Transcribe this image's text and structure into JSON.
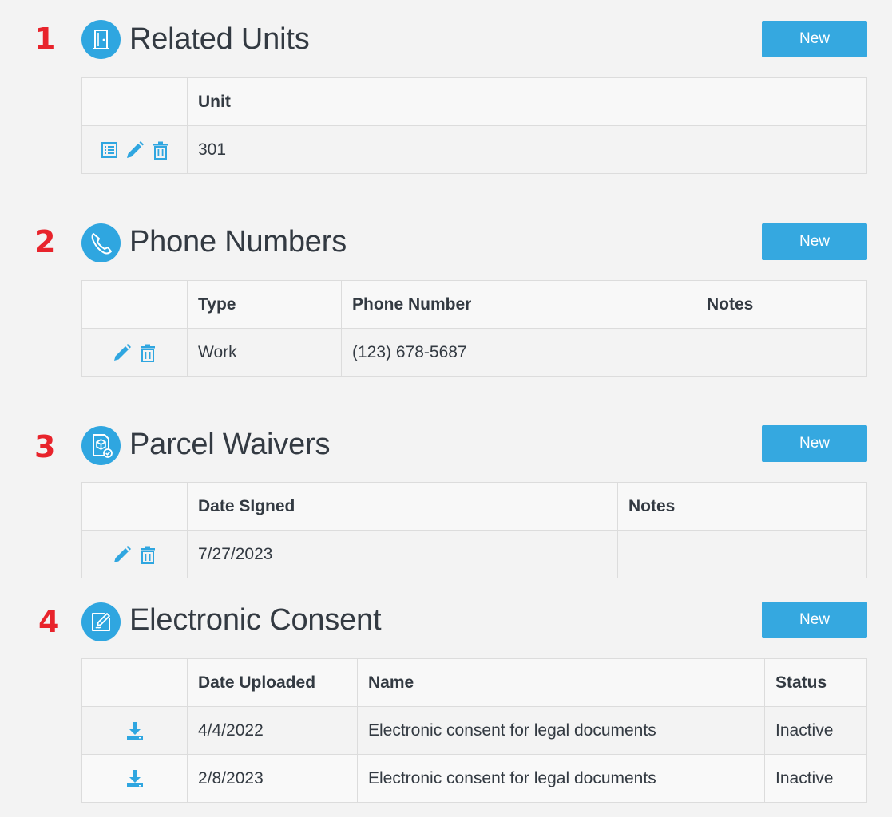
{
  "accent_color": "#2fa6e0",
  "marker_color": "#e8232b",
  "sections": [
    {
      "marker": "1",
      "title": "Related Units",
      "icon": "door-icon",
      "new_label": "New",
      "columns": [
        "Unit"
      ],
      "rows": [
        {
          "actions": [
            "list-icon",
            "edit-icon",
            "delete-icon"
          ],
          "cells": [
            "301"
          ]
        }
      ]
    },
    {
      "marker": "2",
      "title": "Phone Numbers",
      "icon": "phone-icon",
      "new_label": "New",
      "columns": [
        "Type",
        "Phone Number",
        "Notes"
      ],
      "rows": [
        {
          "actions": [
            "edit-icon",
            "delete-icon"
          ],
          "cells": [
            "Work",
            "(123) 678-5687",
            ""
          ]
        }
      ]
    },
    {
      "marker": "3",
      "title": "Parcel Waivers",
      "icon": "parcel-document-icon",
      "new_label": "New",
      "columns": [
        "Date SIgned",
        "Notes"
      ],
      "rows": [
        {
          "actions": [
            "edit-icon",
            "delete-icon"
          ],
          "cells": [
            "7/27/2023",
            ""
          ]
        }
      ]
    },
    {
      "marker": "4",
      "title": "Electronic Consent",
      "icon": "signature-edit-icon",
      "new_label": "New",
      "columns": [
        "Date Uploaded",
        "Name",
        "Status"
      ],
      "rows": [
        {
          "actions": [
            "download-icon"
          ],
          "cells": [
            "4/4/2022",
            "Electronic consent for legal documents",
            "Inactive"
          ]
        },
        {
          "actions": [
            "download-icon"
          ],
          "cells": [
            "2/8/2023",
            "Electronic consent for legal documents",
            "Inactive"
          ]
        }
      ]
    }
  ]
}
